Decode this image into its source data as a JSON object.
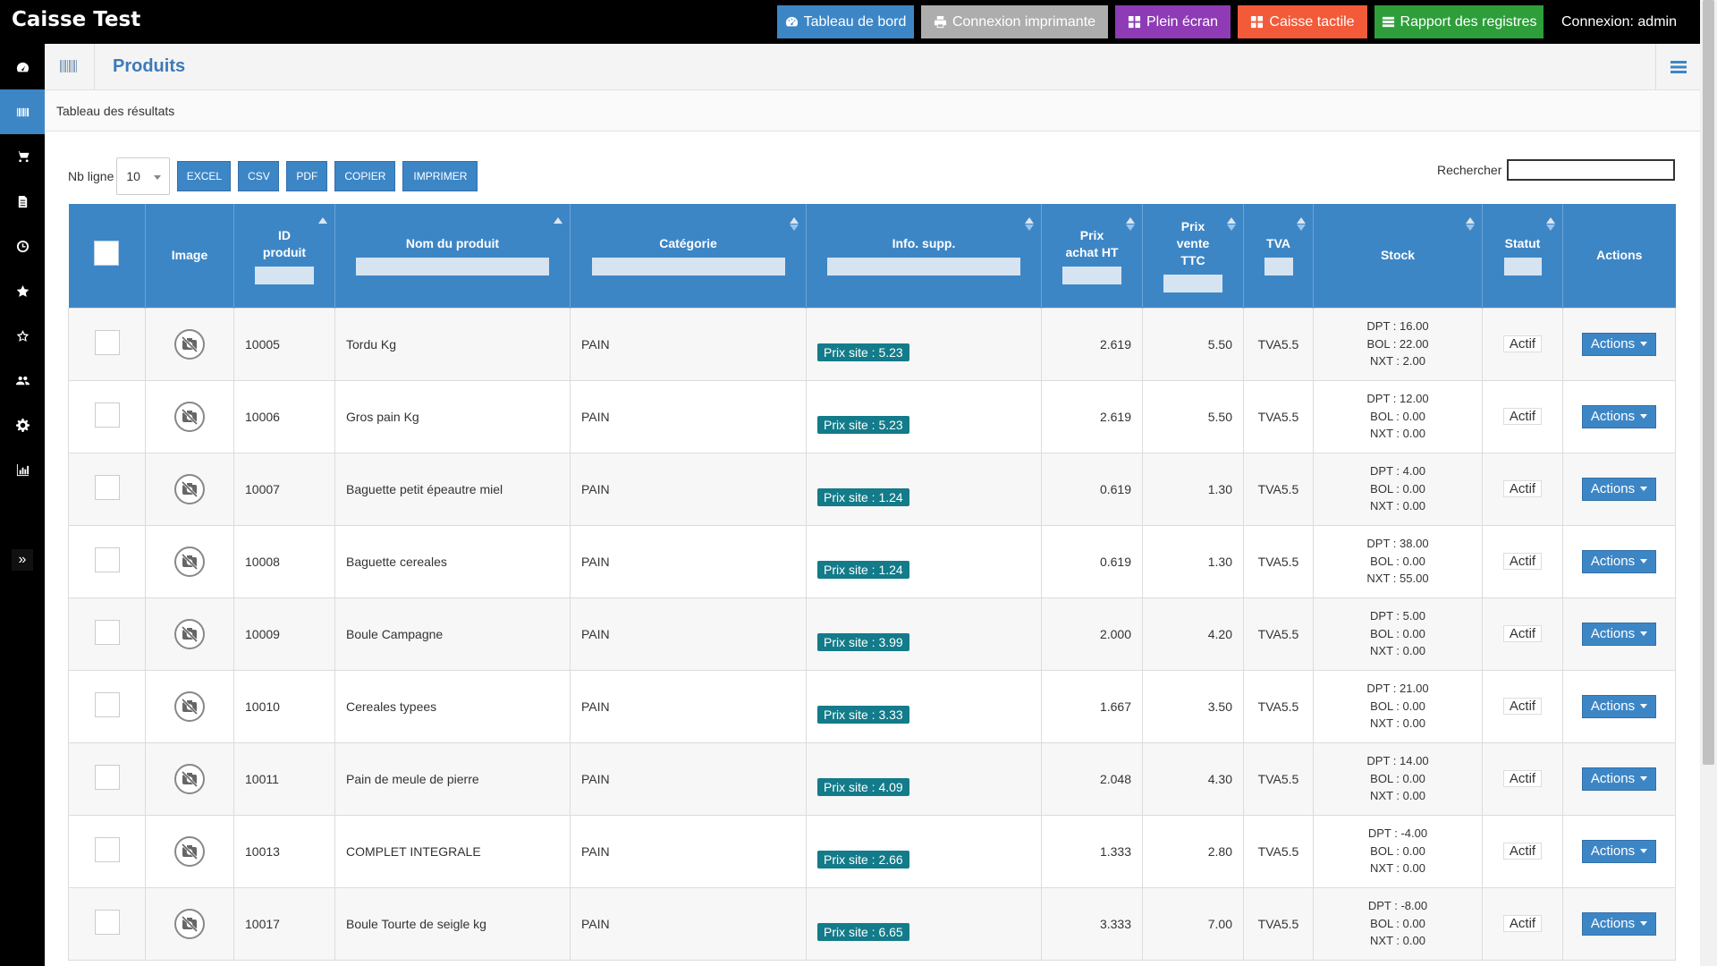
{
  "app": {
    "title": "Caisse Test",
    "login": "Connexion: admin"
  },
  "topbar": {
    "buttons": [
      {
        "label": "Tableau de bord",
        "color": "#3d86c6",
        "icon": "dashboard-icon"
      },
      {
        "label": "Connexion imprimante",
        "color": "#adadad",
        "icon": "printer-icon"
      },
      {
        "label": "Plein écran",
        "color": "#8e3bb5",
        "icon": "grid-icon"
      },
      {
        "label": "Caisse tactile",
        "color": "#f25a39",
        "icon": "grid-icon"
      },
      {
        "label": "Rapport des registres",
        "color": "#2e9e3b",
        "icon": "list-icon"
      }
    ]
  },
  "sidebar": {
    "items": [
      {
        "icon": "dashboard-icon"
      },
      {
        "icon": "barcode-icon",
        "active": true
      },
      {
        "icon": "cart-icon"
      },
      {
        "icon": "file-icon"
      },
      {
        "icon": "clock-icon"
      },
      {
        "icon": "star-icon"
      },
      {
        "icon": "star-outline-icon"
      },
      {
        "icon": "users-icon"
      },
      {
        "icon": "gear-icon"
      },
      {
        "icon": "bar-chart-icon"
      }
    ],
    "expand_label": "»"
  },
  "page": {
    "title": "Produits",
    "subtitle": "Tableau des résultats"
  },
  "controls": {
    "nb_label": "Nb ligne",
    "nb_value": "10",
    "export_buttons": [
      "EXCEL",
      "CSV",
      "PDF",
      "COPIER",
      "IMPRIMER"
    ],
    "search_label": "Rechercher",
    "search_value": ""
  },
  "table": {
    "columns": [
      {
        "key": "select",
        "label": ""
      },
      {
        "key": "image",
        "label": "Image"
      },
      {
        "key": "id",
        "label": "ID\nproduit"
      },
      {
        "key": "name",
        "label": "Nom du produit"
      },
      {
        "key": "category",
        "label": "Catégorie"
      },
      {
        "key": "info",
        "label": "Info. supp."
      },
      {
        "key": "buy",
        "label": "Prix\nachat HT"
      },
      {
        "key": "sell",
        "label": "Prix\nvente\nTTC"
      },
      {
        "key": "tva",
        "label": "TVA"
      },
      {
        "key": "stock",
        "label": "Stock"
      },
      {
        "key": "status",
        "label": "Statut"
      },
      {
        "key": "actions",
        "label": "Actions"
      }
    ],
    "rows": [
      {
        "id": "10005",
        "name": "Tordu Kg",
        "category": "PAIN",
        "info": "Prix site : 5.23",
        "buy": "2.619",
        "sell": "5.50",
        "tva": "TVA5.5",
        "stock": [
          "DPT : 16.00",
          "BOL : 22.00",
          "NXT : 2.00"
        ],
        "status": "Actif",
        "action": "Actions"
      },
      {
        "id": "10006",
        "name": "Gros pain Kg",
        "category": "PAIN",
        "info": "Prix site : 5.23",
        "buy": "2.619",
        "sell": "5.50",
        "tva": "TVA5.5",
        "stock": [
          "DPT : 12.00",
          "BOL : 0.00",
          "NXT : 0.00"
        ],
        "status": "Actif",
        "action": "Actions"
      },
      {
        "id": "10007",
        "name": "Baguette petit épeautre miel",
        "category": "PAIN",
        "info": "Prix site : 1.24",
        "buy": "0.619",
        "sell": "1.30",
        "tva": "TVA5.5",
        "stock": [
          "DPT : 4.00",
          "BOL : 0.00",
          "NXT : 0.00"
        ],
        "status": "Actif",
        "action": "Actions"
      },
      {
        "id": "10008",
        "name": "Baguette cereales",
        "category": "PAIN",
        "info": "Prix site : 1.24",
        "buy": "0.619",
        "sell": "1.30",
        "tva": "TVA5.5",
        "stock": [
          "DPT : 38.00",
          "BOL : 0.00",
          "NXT : 55.00"
        ],
        "status": "Actif",
        "action": "Actions"
      },
      {
        "id": "10009",
        "name": "Boule Campagne",
        "category": "PAIN",
        "info": "Prix site : 3.99",
        "buy": "2.000",
        "sell": "4.20",
        "tva": "TVA5.5",
        "stock": [
          "DPT : 5.00",
          "BOL : 0.00",
          "NXT : 0.00"
        ],
        "status": "Actif",
        "action": "Actions"
      },
      {
        "id": "10010",
        "name": "Cereales typees",
        "category": "PAIN",
        "info": "Prix site : 3.33",
        "buy": "1.667",
        "sell": "3.50",
        "tva": "TVA5.5",
        "stock": [
          "DPT : 21.00",
          "BOL : 0.00",
          "NXT : 0.00"
        ],
        "status": "Actif",
        "action": "Actions"
      },
      {
        "id": "10011",
        "name": "Pain de meule de pierre",
        "category": "PAIN",
        "info": "Prix site : 4.09",
        "buy": "2.048",
        "sell": "4.30",
        "tva": "TVA5.5",
        "stock": [
          "DPT : 14.00",
          "BOL : 0.00",
          "NXT : 0.00"
        ],
        "status": "Actif",
        "action": "Actions"
      },
      {
        "id": "10013",
        "name": "COMPLET INTEGRALE",
        "category": "PAIN",
        "info": "Prix site : 2.66",
        "buy": "1.333",
        "sell": "2.80",
        "tva": "TVA5.5",
        "stock": [
          "DPT : -4.00",
          "BOL : 0.00",
          "NXT : 0.00"
        ],
        "status": "Actif",
        "action": "Actions"
      },
      {
        "id": "10017",
        "name": "Boule Tourte de seigle kg",
        "category": "PAIN",
        "info": "Prix site : 6.65",
        "buy": "3.333",
        "sell": "7.00",
        "tva": "TVA5.5",
        "stock": [
          "DPT : -8.00",
          "BOL : 0.00",
          "NXT : 0.00"
        ],
        "status": "Actif",
        "action": "Actions"
      }
    ]
  }
}
